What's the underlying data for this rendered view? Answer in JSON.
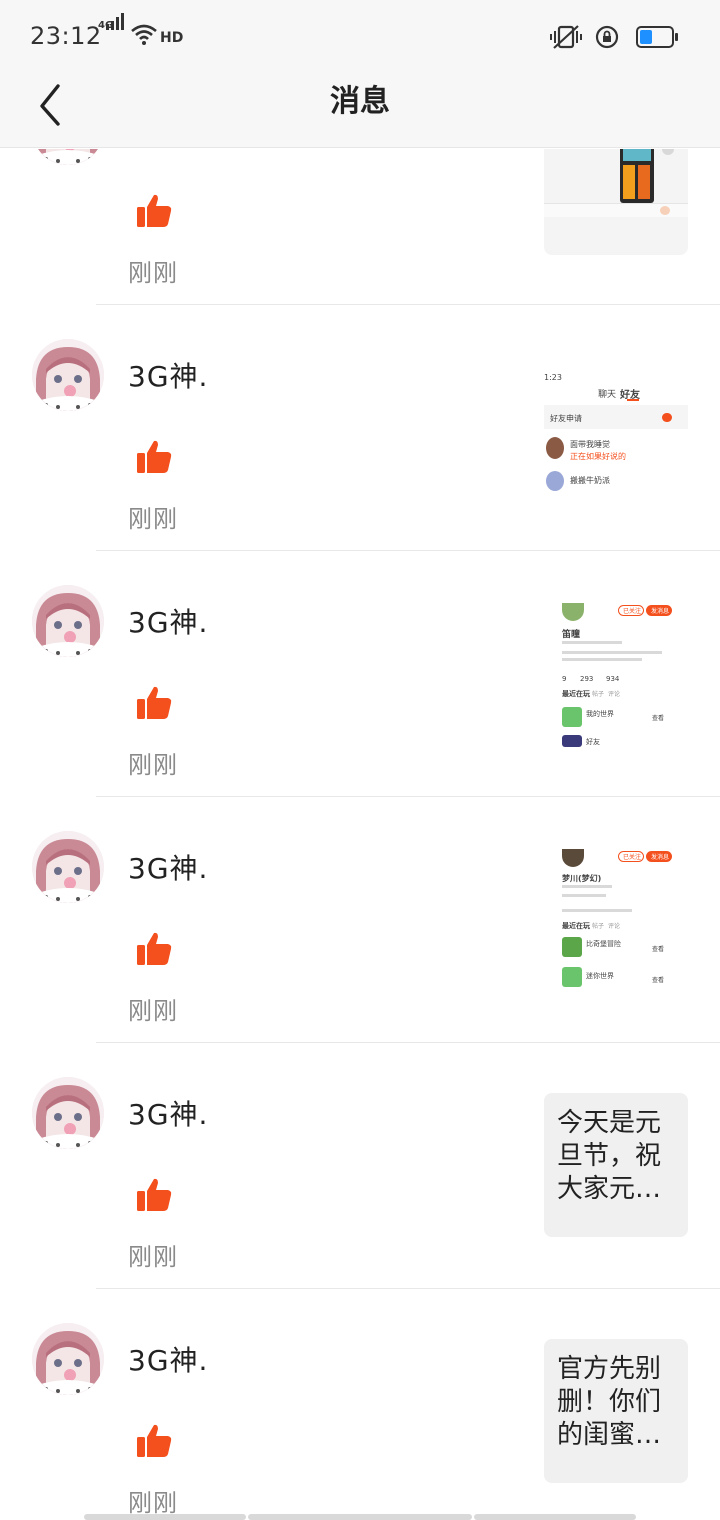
{
  "status_bar": {
    "time": "23:12",
    "network": "4G",
    "hd": "HD"
  },
  "header": {
    "title": "消息",
    "back_icon": "chevron-left-icon"
  },
  "accent_color": "#f4501e",
  "notifications": [
    {
      "username": "",
      "action_icon": "thumbs-up-icon",
      "time": "刚刚",
      "preview": {
        "kind": "chat-screenshot",
        "texts": []
      }
    },
    {
      "username": "3G神.",
      "action_icon": "thumbs-up-icon",
      "time": "刚刚",
      "preview": {
        "kind": "friends-screenshot",
        "texts": [
          "1:23",
          "聊天",
          "好友",
          "好友申请",
          "面带我睡觉",
          "正在如果好说的",
          "搬搬牛奶派"
        ]
      }
    },
    {
      "username": "3G神.",
      "action_icon": "thumbs-up-icon",
      "time": "刚刚",
      "preview": {
        "kind": "profile-screenshot",
        "texts": [
          "已关注",
          "发消息",
          "笛瞳",
          "9",
          "293",
          "934",
          "最近在玩",
          "帖子",
          "评论",
          "我的世界",
          "查看",
          "好友"
        ]
      }
    },
    {
      "username": "3G神.",
      "action_icon": "thumbs-up-icon",
      "time": "刚刚",
      "preview": {
        "kind": "profile-screenshot",
        "texts": [
          "已关注",
          "发消息",
          "梦川(梦幻)",
          "最近在玩",
          "帖子",
          "评论",
          "比奇堡冒险",
          "查看",
          "迷你世界",
          "查看"
        ]
      }
    },
    {
      "username": "3G神.",
      "action_icon": "thumbs-up-icon",
      "time": "刚刚",
      "preview": {
        "kind": "text",
        "text": "今天是元旦节，祝大家元…"
      }
    },
    {
      "username": "3G神.",
      "action_icon": "thumbs-up-icon",
      "time": "刚刚",
      "preview": {
        "kind": "text",
        "text": "官方先别删！你们的闺蜜…"
      }
    }
  ]
}
